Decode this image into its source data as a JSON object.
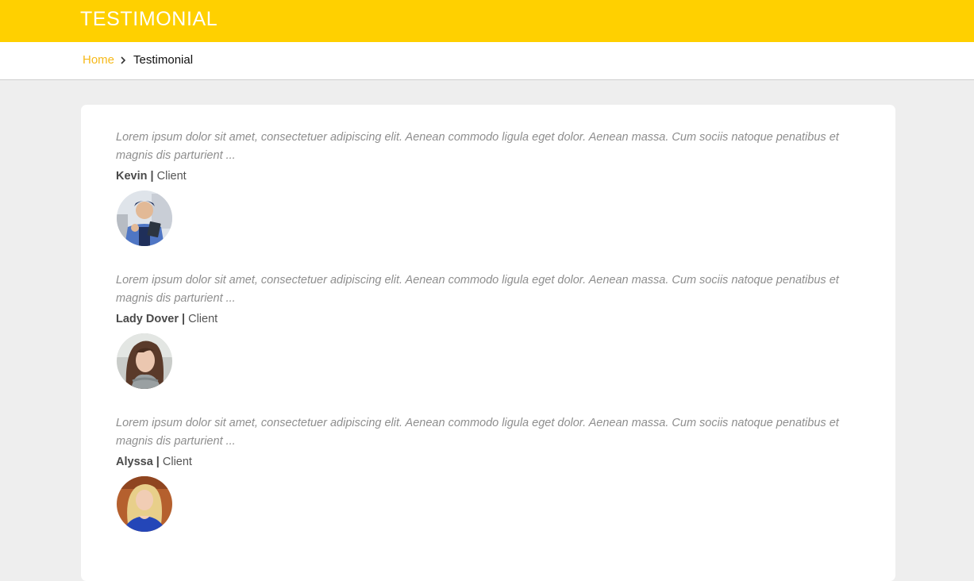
{
  "header": {
    "title": "TESTIMONIAL"
  },
  "breadcrumb": {
    "home": "Home",
    "current": "Testimonial"
  },
  "testimonials": [
    {
      "quote": "Lorem ipsum dolor sit amet, consectetuer adipiscing elit. Aenean commodo ligula eget dolor. Aenean massa. Cum sociis natoque penatibus et magnis dis parturient ...",
      "name": "Kevin",
      "separator": "|",
      "role": "Client"
    },
    {
      "quote": "Lorem ipsum dolor sit amet, consectetuer adipiscing elit. Aenean commodo ligula eget dolor. Aenean massa. Cum sociis natoque penatibus et magnis dis parturient ...",
      "name": "Lady Dover",
      "separator": "|",
      "role": "Client"
    },
    {
      "quote": "Lorem ipsum dolor sit amet, consectetuer adipiscing elit. Aenean commodo ligula eget dolor. Aenean massa. Cum sociis natoque penatibus et magnis dis parturient ...",
      "name": "Alyssa",
      "separator": "|",
      "role": "Client"
    }
  ],
  "colors": {
    "accent": "#ffd000",
    "link": "#f6b91a",
    "background": "#eeeeee"
  },
  "icons": {
    "breadcrumb_separator": "chevron-right-icon"
  }
}
